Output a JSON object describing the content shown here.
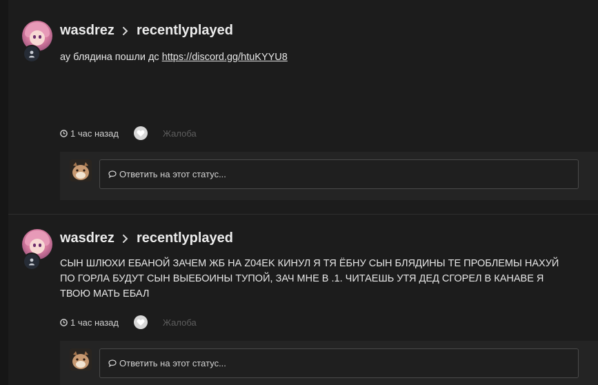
{
  "posts": [
    {
      "author": "wasdrez",
      "target": "recentlyplayed",
      "text_prefix": "ау блядина пошли дс ",
      "link": "https://discord.gg/htuKYYU8",
      "time": "1 час назад",
      "report_label": "Жалоба",
      "reply_placeholder": "Ответить на этот статус..."
    },
    {
      "author": "wasdrez",
      "target": "recentlyplayed",
      "text_prefix": "СЫН ШЛЮХИ ЕБАНОЙ ЗАЧЕМ ЖБ НА Z04EK КИНУЛ Я ТЯ ЁБНУ СЫН БЛЯДИНЫ ТЕ ПРОБЛЕМЫ НАХУЙ ПО ГОРЛА БУДУТ СЫН ВЫЕБОИНЫ ТУПОЙ, ЗАЧ МНЕ В .1. ЧИТАЕШЬ УТЯ ДЕД СГОРЕЛ В КАНАВЕ Я ТВОЮ МАТЬ ЕБАЛ",
      "link": "",
      "time": "1 час назад",
      "report_label": "Жалоба",
      "reply_placeholder": "Ответить на этот статус..."
    }
  ],
  "icons": {
    "clock": "clock-icon",
    "heart": "heart-icon",
    "chevron": "chevron-right-icon",
    "user": "user-icon",
    "comment": "comment-icon"
  },
  "colors": {
    "background": "#1c1c1c",
    "text": "#e6e6e6",
    "muted": "#5e5e5e",
    "reply_panel": "#242424"
  }
}
